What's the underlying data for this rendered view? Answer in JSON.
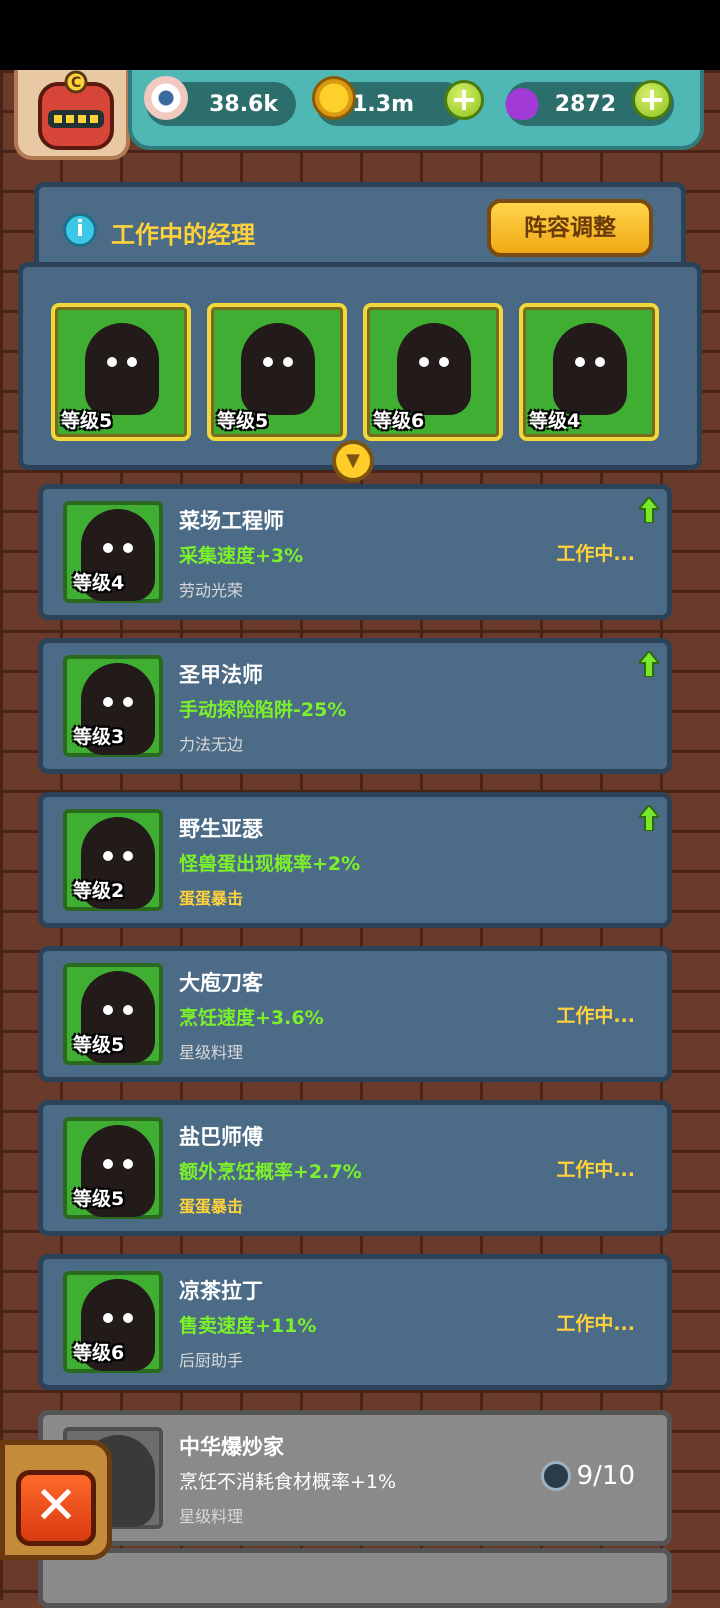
{
  "resources": [
    {
      "icon": "eyeball-icon",
      "value": "38.6k"
    },
    {
      "icon": "coin-icon",
      "value": "1.3m"
    },
    {
      "icon": "potion-icon",
      "value": "2872"
    }
  ],
  "header": {
    "title": "工作中的经理",
    "adjust_button": "阵容调整"
  },
  "team_slots": [
    {
      "level": "等级5"
    },
    {
      "level": "等级5"
    },
    {
      "level": "等级6"
    },
    {
      "level": "等级4"
    }
  ],
  "managers": [
    {
      "level": "等级4",
      "name": "菜场工程师",
      "buff": "采集速度+3%",
      "trait": "劳动光荣",
      "status": "工作中...",
      "upgradable": true
    },
    {
      "level": "等级3",
      "name": "圣甲法师",
      "buff": "手动探险陷阱-25%",
      "trait": "力法无边",
      "status": "",
      "upgradable": true
    },
    {
      "level": "等级2",
      "name": "野生亚瑟",
      "buff": "怪兽蛋出现概率+2%",
      "trait": "蛋蛋暴击",
      "status": "",
      "upgradable": true
    },
    {
      "level": "等级5",
      "name": "大庖刀客",
      "buff": "烹饪速度+3.6%",
      "trait": "星级料理",
      "status": "工作中...",
      "upgradable": false
    },
    {
      "level": "等级5",
      "name": "盐巴师傅",
      "buff": "额外烹饪概率+2.7%",
      "trait": "蛋蛋暴击",
      "status": "工作中...",
      "upgradable": false
    },
    {
      "level": "等级6",
      "name": "凉茶拉丁",
      "buff": "售卖速度+11%",
      "trait": "后厨助手",
      "status": "工作中...",
      "upgradable": false
    }
  ],
  "locked_manager": {
    "name": "中华爆炒家",
    "buff": "烹饪不消耗食材概率+1%",
    "trait": "星级料理",
    "progress": "9/10"
  },
  "colors": {
    "gold_text": "#ffd13a",
    "buff_green": "#7cf02a",
    "panel": "#4b6b86"
  }
}
